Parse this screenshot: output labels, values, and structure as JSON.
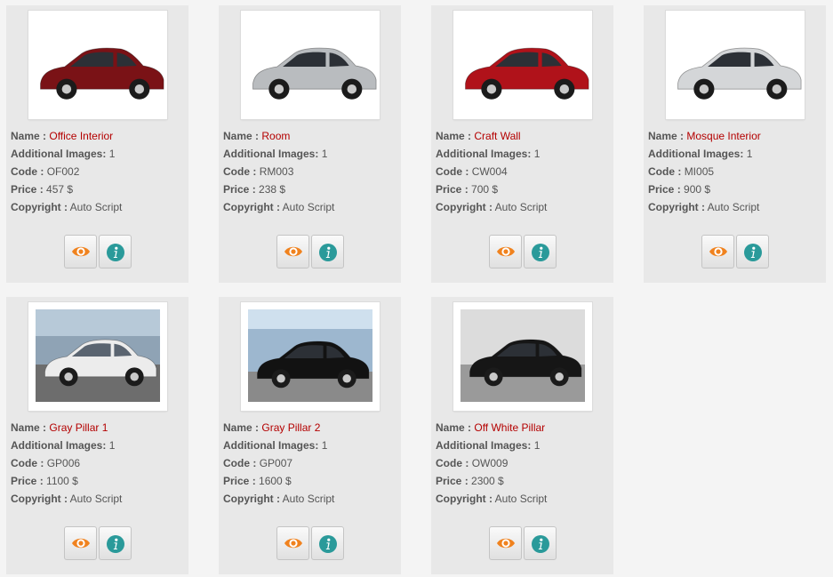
{
  "labels": {
    "name": "Name :",
    "additional_images": "Additional Images:",
    "code": "Code :",
    "price": "Price :",
    "copyright": "Copyright :"
  },
  "icons": {
    "view": "eye-icon",
    "info": "info-icon"
  },
  "colors": {
    "name_link": "#b40000",
    "eye_icon": "#f0821e",
    "info_icon": "#2a9a9a"
  },
  "products": [
    {
      "name": "Office Interior",
      "additional_images": "1",
      "code": "OF002",
      "price": "457 $",
      "copyright": "Auto Script",
      "car_color": "#7a1216",
      "photo": "white-studio"
    },
    {
      "name": "Room",
      "additional_images": "1",
      "code": "RM003",
      "price": "238 $",
      "copyright": "Auto Script",
      "car_color": "#b9bcbf",
      "photo": "white-studio"
    },
    {
      "name": "Craft Wall",
      "additional_images": "1",
      "code": "CW004",
      "price": "700 $",
      "copyright": "Auto Script",
      "car_color": "#b0121a",
      "photo": "white-studio"
    },
    {
      "name": "Mosque Interior",
      "additional_images": "1",
      "code": "MI005",
      "price": "900 $",
      "copyright": "Auto Script",
      "car_color": "#d4d6d8",
      "photo": "white-studio"
    },
    {
      "name": "Gray Pillar 1",
      "additional_images": "1",
      "code": "GP006",
      "price": "1100 $",
      "copyright": "Auto Script",
      "car_color": "#ececec",
      "photo": "parking-lot"
    },
    {
      "name": "Gray Pillar 2",
      "additional_images": "1",
      "code": "GP007",
      "price": "1600 $",
      "copyright": "Auto Script",
      "car_color": "#121212",
      "photo": "outdoor-lot"
    },
    {
      "name": "Off White Pillar",
      "additional_images": "1",
      "code": "OW009",
      "price": "2300 $",
      "copyright": "Auto Script",
      "car_color": "#161616",
      "photo": "showroom"
    }
  ]
}
